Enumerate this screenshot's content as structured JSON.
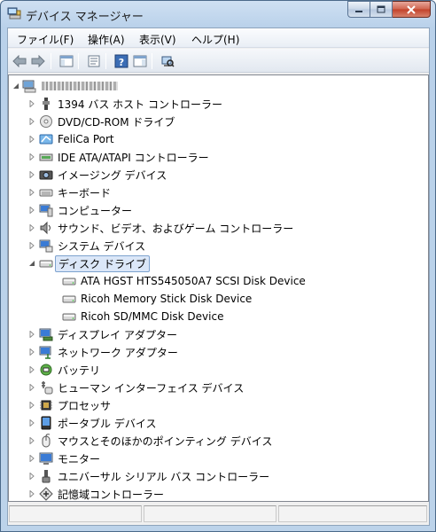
{
  "window": {
    "title": "デバイス マネージャー",
    "icon": "device-manager-icon",
    "controls": {
      "minimize": "minimize-icon",
      "maximize": "maximize-icon",
      "close": "close-icon"
    }
  },
  "menubar": {
    "items": [
      {
        "label": "ファイル(F)"
      },
      {
        "label": "操作(A)"
      },
      {
        "label": "表示(V)"
      },
      {
        "label": "ヘルプ(H)"
      }
    ]
  },
  "toolbar": {
    "buttons": [
      "back-icon",
      "forward-icon",
      "show-hide-console-tree-icon",
      "properties-icon",
      "help-icon",
      "action-pane-icon",
      "scan-hardware-icon"
    ]
  },
  "tree": {
    "root": {
      "label_blurred": true,
      "icon": "computer-icon"
    },
    "items": [
      {
        "label": "1394 バス ホスト コントローラー",
        "icon": "firewire-icon",
        "expanded": false
      },
      {
        "label": "DVD/CD-ROM ドライブ",
        "icon": "optical-drive-icon",
        "expanded": false
      },
      {
        "label": "FeliCa Port",
        "icon": "felica-icon",
        "expanded": false
      },
      {
        "label": "IDE ATA/ATAPI コントローラー",
        "icon": "ide-controller-icon",
        "expanded": false
      },
      {
        "label": "イメージング デバイス",
        "icon": "camera-icon",
        "expanded": false
      },
      {
        "label": "キーボード",
        "icon": "keyboard-icon",
        "expanded": false
      },
      {
        "label": "コンピューター",
        "icon": "computer-icon",
        "expanded": false
      },
      {
        "label": "サウンド、ビデオ、およびゲーム コントローラー",
        "icon": "speaker-icon",
        "expanded": false
      },
      {
        "label": "システム デバイス",
        "icon": "system-device-icon",
        "expanded": false
      },
      {
        "label": "ディスク ドライブ",
        "icon": "disk-drive-icon",
        "expanded": true,
        "selected": true,
        "children": [
          {
            "label": "ATA HGST HTS545050A7 SCSI Disk Device",
            "icon": "disk-drive-icon"
          },
          {
            "label": "Ricoh Memory Stick Disk Device",
            "icon": "disk-drive-icon"
          },
          {
            "label": "Ricoh SD/MMC Disk Device",
            "icon": "disk-drive-icon"
          }
        ]
      },
      {
        "label": "ディスプレイ アダプター",
        "icon": "display-adapter-icon",
        "expanded": false
      },
      {
        "label": "ネットワーク アダプター",
        "icon": "network-adapter-icon",
        "expanded": false
      },
      {
        "label": "バッテリ",
        "icon": "battery-icon",
        "expanded": false
      },
      {
        "label": "ヒューマン インターフェイス デバイス",
        "icon": "hid-icon",
        "expanded": false
      },
      {
        "label": "プロセッサ",
        "icon": "processor-icon",
        "expanded": false
      },
      {
        "label": "ポータブル デバイス",
        "icon": "portable-device-icon",
        "expanded": false
      },
      {
        "label": "マウスとそのほかのポインティング デバイス",
        "icon": "mouse-icon",
        "expanded": false
      },
      {
        "label": "モニター",
        "icon": "monitor-icon",
        "expanded": false
      },
      {
        "label": "ユニバーサル シリアル バス コントローラー",
        "icon": "usb-icon",
        "expanded": false
      },
      {
        "label": "記憶域コントローラー",
        "icon": "storage-controller-icon",
        "expanded": false
      }
    ]
  },
  "statusbar": {
    "panes": 3
  },
  "colors": {
    "title_gradient_top": "#cfe0f2",
    "selection_bg": "#dbe7f8",
    "selection_border": "#7da2ce"
  }
}
